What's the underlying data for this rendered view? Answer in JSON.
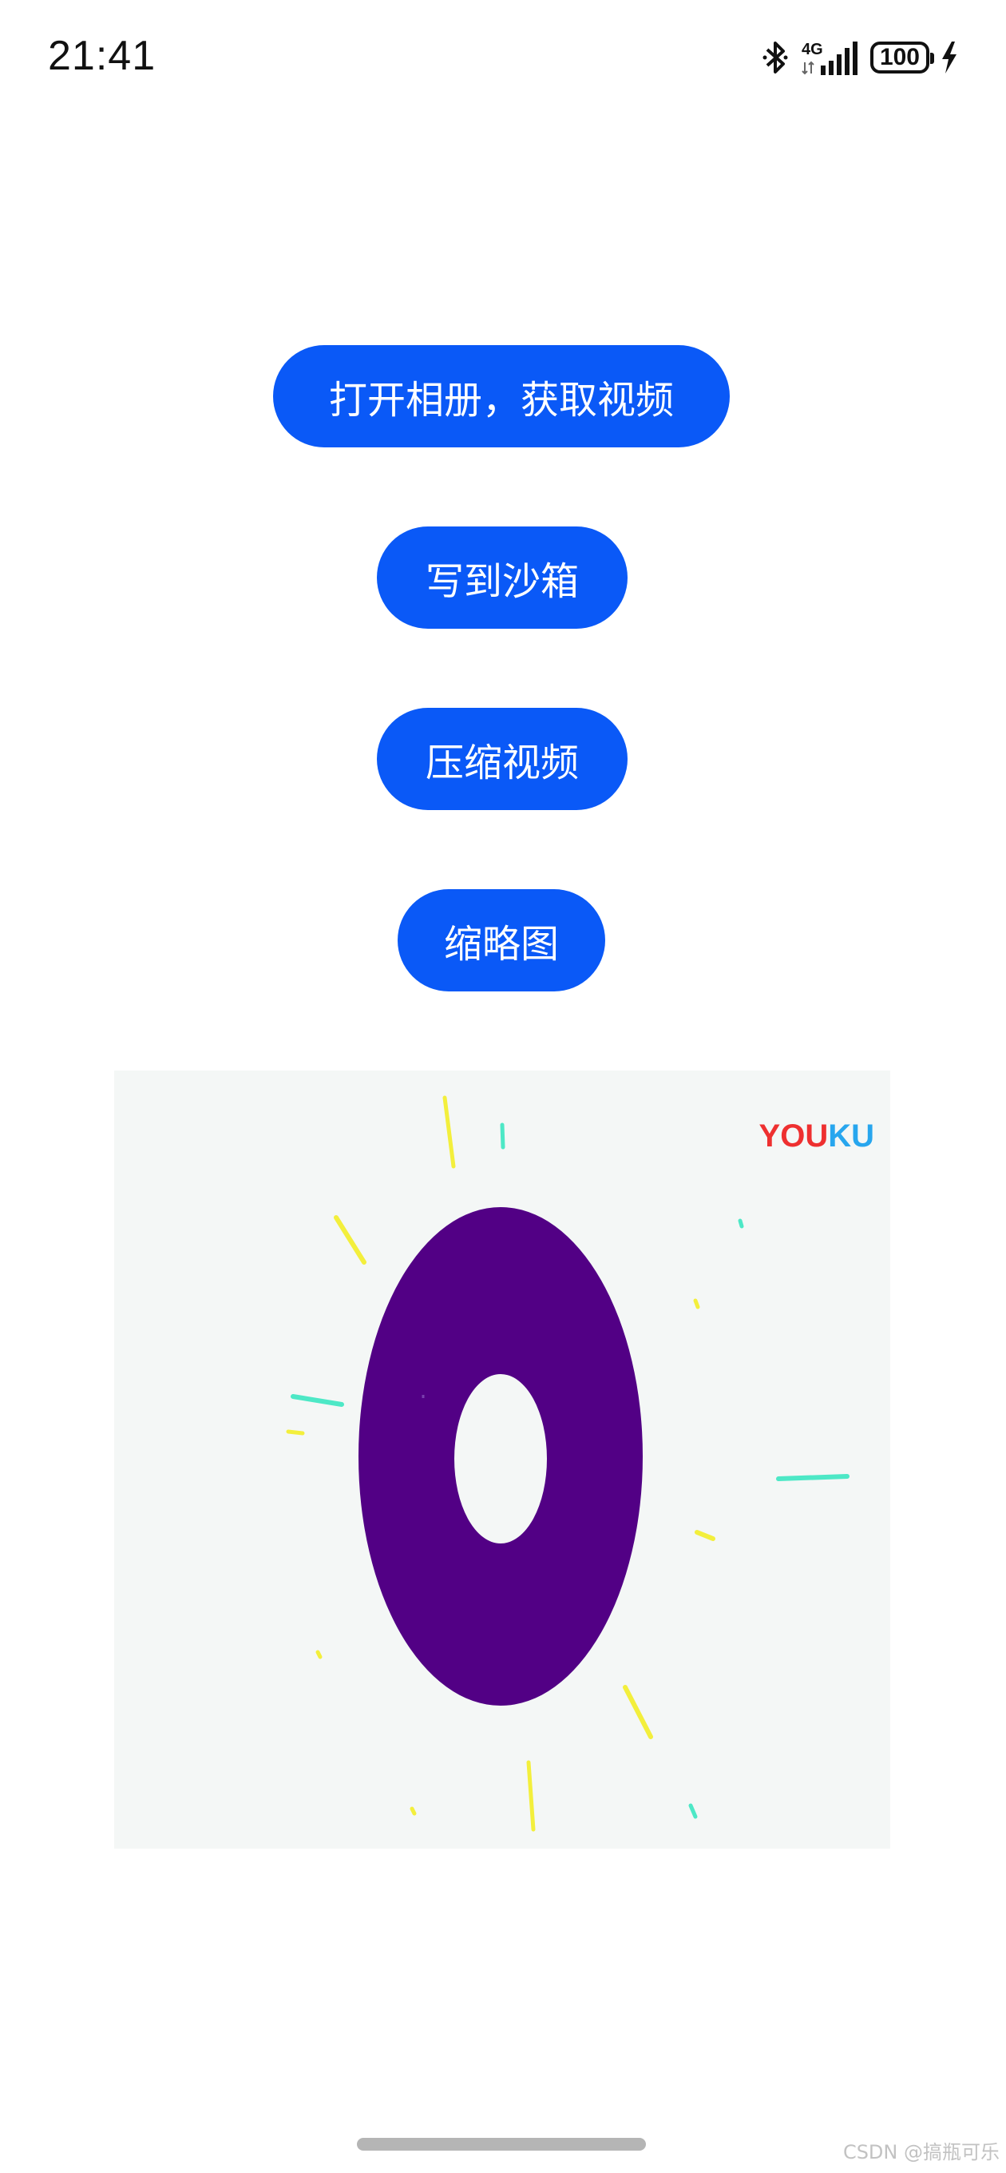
{
  "status_bar": {
    "time": "21:41",
    "network": "4G",
    "battery": "100",
    "icons": [
      "bluetooth-icon",
      "signal-icon",
      "battery-icon",
      "charging-icon"
    ]
  },
  "buttons": {
    "open_album": "打开相册，获取视频",
    "write_sandbox": "写到沙箱",
    "compress_video": "压缩视频",
    "thumbnail": "缩略图"
  },
  "thumbnail": {
    "watermark_prefix": "YOU",
    "watermark_suffix": "KU"
  },
  "footer": {
    "credit": "CSDN @搞瓶可乐"
  },
  "colors": {
    "accent": "#0a59f7",
    "ring": "#520085",
    "thumb_bg": "#f4f7f6",
    "ray_yellow": "#f3ef3c",
    "ray_cyan": "#4de8c6",
    "logo_red": "#ee3030",
    "logo_blue": "#27a6ee"
  }
}
